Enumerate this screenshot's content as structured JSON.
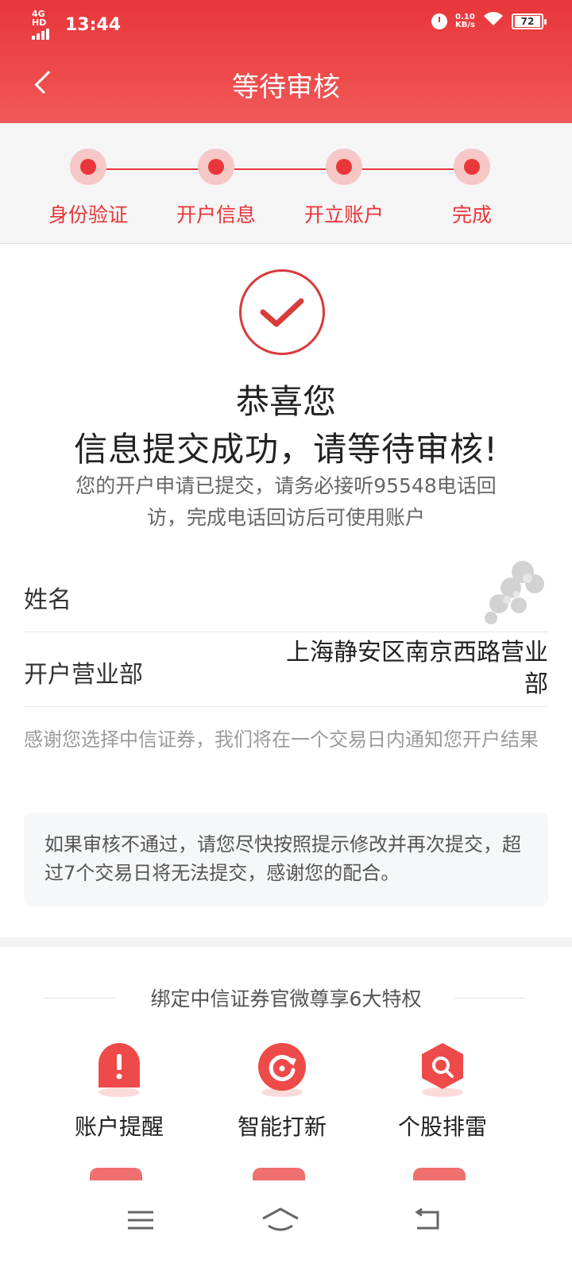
{
  "status_bar": {
    "network": "4G HD",
    "time": "13:44",
    "speed_value": "0.10",
    "speed_unit": "KB/s",
    "battery": "72"
  },
  "header": {
    "title": "等待审核"
  },
  "steps": [
    {
      "label": "身份验证"
    },
    {
      "label": "开户信息"
    },
    {
      "label": "开立账户"
    },
    {
      "label": "完成"
    }
  ],
  "result": {
    "congrats": "恭喜您",
    "headline": "信息提交成功，请等待审核!",
    "desc": "您的开户申请已提交，请务必接听95548电话回访，完成电话回访后可使用账户"
  },
  "info": {
    "name_label": "姓名",
    "name_value": "",
    "branch_label": "开户营业部",
    "branch_value": "上海静安区南京西路营业部"
  },
  "thanks_text": "感谢您选择中信证券，我们将在一个交易日内通知您开户结果",
  "notice_text": "如果审核不通过，请您尽快按照提示修改并再次提交，超过7个交易日将无法提交，感谢您的配合。",
  "bind": {
    "title": "绑定中信证券官微尊享6大特权",
    "features": [
      {
        "label": "账户提醒",
        "icon": "alert-bell-icon"
      },
      {
        "label": "智能打新",
        "icon": "refresh-icon"
      },
      {
        "label": "个股排雷",
        "icon": "search-icon"
      }
    ]
  },
  "colors": {
    "primary": "#e8363a",
    "step_halo": "#f6c7c6"
  }
}
